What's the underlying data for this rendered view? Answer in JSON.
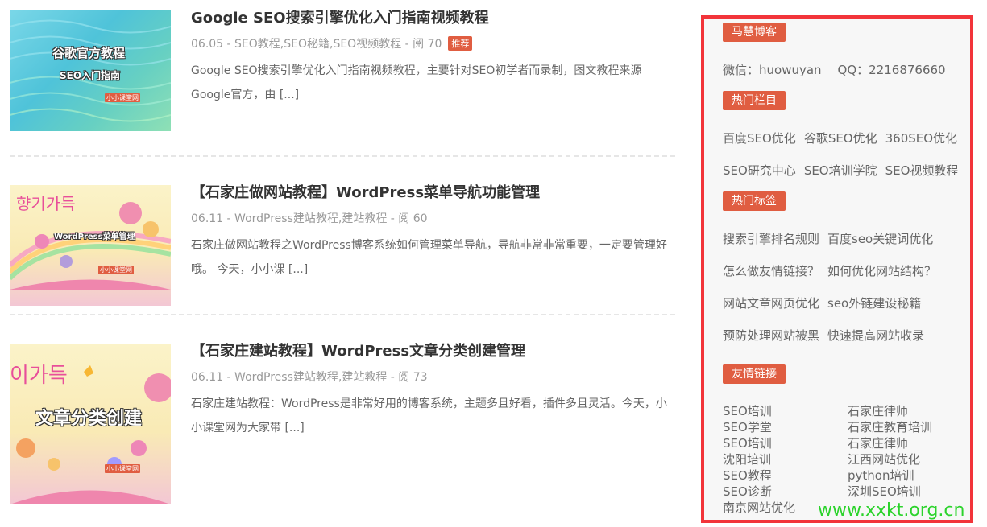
{
  "posts": [
    {
      "title": "Google SEO搜索引擎优化入门指南视频教程",
      "date": "06.05",
      "categories": "SEO教程,SEO秘籍,SEO视频教程",
      "views": "阅 70",
      "badge": "推荐",
      "excerpt": "Google SEO搜索引擎优化入门指南视频教程，主要针对SEO初学者而录制，图文教程来源Google官方，由",
      "more": "[...]",
      "thumb_line1": "谷歌官方教程",
      "thumb_line2": "SEO入门指南",
      "thumb_logo": "小小课堂网"
    },
    {
      "title": "【石家庄做网站教程】WordPress菜单导航功能管理",
      "date": "06.11",
      "categories": "WordPress建站教程,建站教程",
      "views": "阅 60",
      "excerpt": "石家庄做网站教程之WordPress博客系统如何管理菜单导航，导航非常非常重要，一定要管理好哦。 今天，小小课",
      "more": "[...]",
      "thumb_line1": "WordPress菜单管理",
      "thumb_logo": "小小课堂网"
    },
    {
      "title": "【石家庄建站教程】WordPress文章分类创建管理",
      "date": "06.11",
      "categories": "WordPress建站教程,建站教程",
      "views": "阅 73",
      "excerpt": "石家庄建站教程：WordPress是非常好用的博客系统，主题多且好看，插件多且灵活。今天，小小课堂网为大家带",
      "more": "[...]",
      "thumb_line1": "文章分类创建",
      "thumb_logo": "小小课堂网"
    }
  ],
  "sep": " - ",
  "sidebar": {
    "blogger_tag": "马慧博客",
    "wechat": "微信：huowuyan",
    "qq": "QQ：2216876660",
    "hot_columns_tag": "热门栏目",
    "hot_columns": [
      "百度SEO优化",
      "谷歌SEO优化",
      "360SEO优化",
      "SEO研究中心",
      "SEO培训学院",
      "SEO视频教程"
    ],
    "hot_tags_tag": "热门标签",
    "hot_tags": [
      "搜索引擎排名规则",
      "百度seo关键词优化",
      "怎么做友情链接？",
      "如何优化网站结构？",
      "网站文章网页优化",
      "seo外链建设秘籍",
      "预防处理网站被黑",
      "快速提高网站收录"
    ],
    "friend_links_tag": "友情链接",
    "friend_links_left": [
      "SEO培训",
      "SEO学堂",
      "SEO培训",
      "沈阳培训",
      "SEO教程",
      "SEO诊断",
      "南京网站优化"
    ],
    "friend_links_right": [
      "石家庄律师",
      "石家庄教育培训",
      "石家庄律师",
      "江西网站优化",
      "python培训",
      "深圳SEO培训"
    ]
  },
  "watermark": "www.xxkt.org.cn",
  "colors": {
    "accent": "#e05d41",
    "frame": "#f2343a",
    "watermark": "#2cd32c"
  }
}
